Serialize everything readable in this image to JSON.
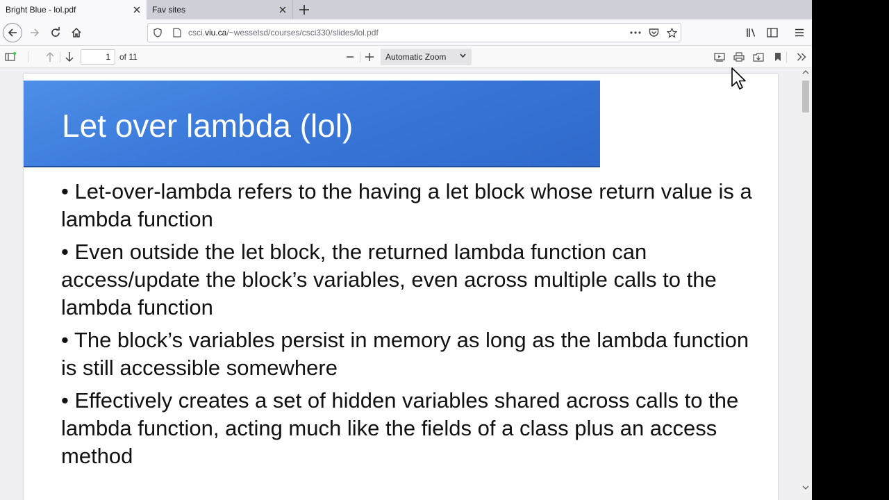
{
  "tabs": [
    {
      "title": "Bright Blue - lol.pdf",
      "active": true
    },
    {
      "title": "Fav sites",
      "active": false
    }
  ],
  "url": {
    "prefix": "csci.",
    "host": "viu.ca",
    "path": "/~wesselsd/courses/csci330/slides/lol.pdf"
  },
  "pdf_toolbar": {
    "page_number": "1",
    "page_count": "of 11",
    "zoom": "Automatic Zoom"
  },
  "slide": {
    "title": "Let over lambda (lol)",
    "bullets": [
      "• Let-over-lambda refers to the having a let block whose return value is a lambda function",
      "• Even outside the let block, the returned lambda function can access/update the block’s variables, even across multiple calls to the lambda function",
      "• The block’s variables persist in memory as long as the lambda function is still accessible somewhere",
      "• Effectively creates a set of hidden variables shared across calls to the lambda function, acting much like the fields of a class plus an access method"
    ],
    "banner_color": "#3a78d9"
  },
  "icons": {
    "tab_close": "close-icon",
    "new_tab": "plus-icon",
    "back": "arrow-left-icon",
    "forward": "arrow-right-icon",
    "reload": "reload-icon",
    "home": "home-icon",
    "shield": "shield-icon",
    "page": "page-icon",
    "more": "more-icon",
    "pocket": "pocket-icon",
    "bookmark_star": "star-icon",
    "library": "library-icon",
    "sidebar": "sidebar-icon",
    "menu": "hamburger-icon",
    "sidebar_toggle": "sidebar-toggle-icon",
    "prev_page": "arrow-up-icon",
    "next_page": "arrow-down-icon",
    "zoom_out": "minus-icon",
    "zoom_in": "plus-icon",
    "presentation": "presentation-icon",
    "print": "print-icon",
    "save": "download-icon",
    "bookmark": "bookmark-icon",
    "tools": "chevron-double-right-icon"
  }
}
